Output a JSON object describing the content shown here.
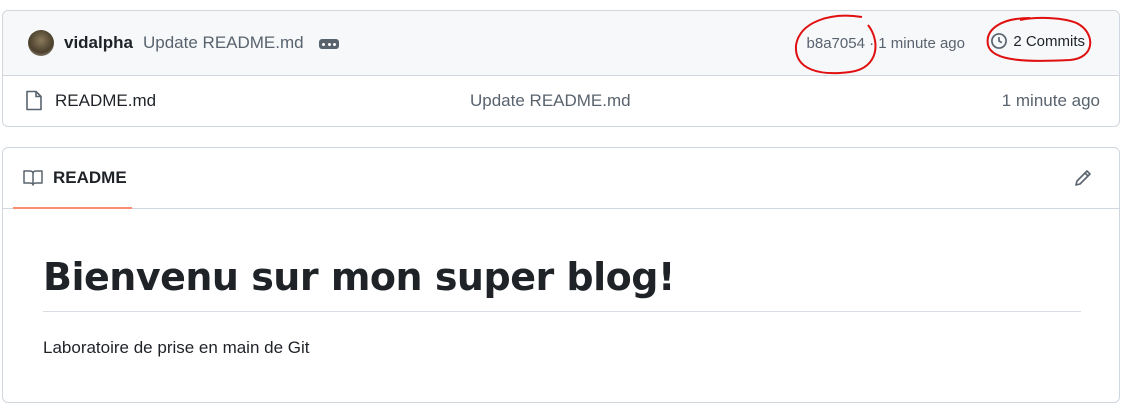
{
  "commit_bar": {
    "author": "vidalpha",
    "message": "Update README.md",
    "hash": "b8a7054",
    "time": "1 minute ago",
    "commits_label": "2 Commits"
  },
  "files": [
    {
      "name": "README.md",
      "commit_message": "Update README.md",
      "age": "1 minute ago"
    }
  ],
  "readme": {
    "tab_label": "README",
    "heading": "Bienvenu sur mon super blog!",
    "paragraph": "Laboratoire de prise en main de Git"
  },
  "colors": {
    "annotation": "#e01010",
    "tab_underline": "#fd8c73"
  }
}
